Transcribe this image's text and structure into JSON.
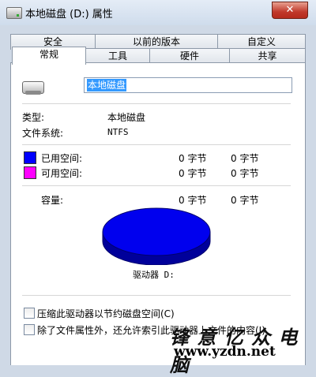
{
  "window": {
    "title": "本地磁盘 (D:) 属性",
    "close_glyph": "✕"
  },
  "tabs_back": [
    "安全",
    "以前的版本",
    "自定义"
  ],
  "tabs_front": [
    "常规",
    "工具",
    "硬件",
    "共享"
  ],
  "general": {
    "name_value": "本地磁盘",
    "type_label": "类型:",
    "type_value": "本地磁盘",
    "fs_label": "文件系统:",
    "fs_value": "NTFS",
    "used": {
      "label": "已用空间:",
      "bytes": "0 字节",
      "size": "0 字节",
      "color": "#0000ff"
    },
    "free": {
      "label": "可用空间:",
      "bytes": "0 字节",
      "size": "0 字节",
      "color": "#ff00ff"
    },
    "capacity": {
      "label": "容量:",
      "bytes": "0 字节",
      "size": "0 字节"
    },
    "pie_color": "#0000ee",
    "drive_label": "驱动器 D:",
    "compress_label": "压缩此驱动器以节约磁盘空间(C)",
    "index_label": "除了文件属性外，还允许索引此驱动器上文件的内容(I)"
  },
  "watermark": {
    "top": "锋 意 亿 众 电 脑",
    "bottom": "www.yzdn.net"
  }
}
